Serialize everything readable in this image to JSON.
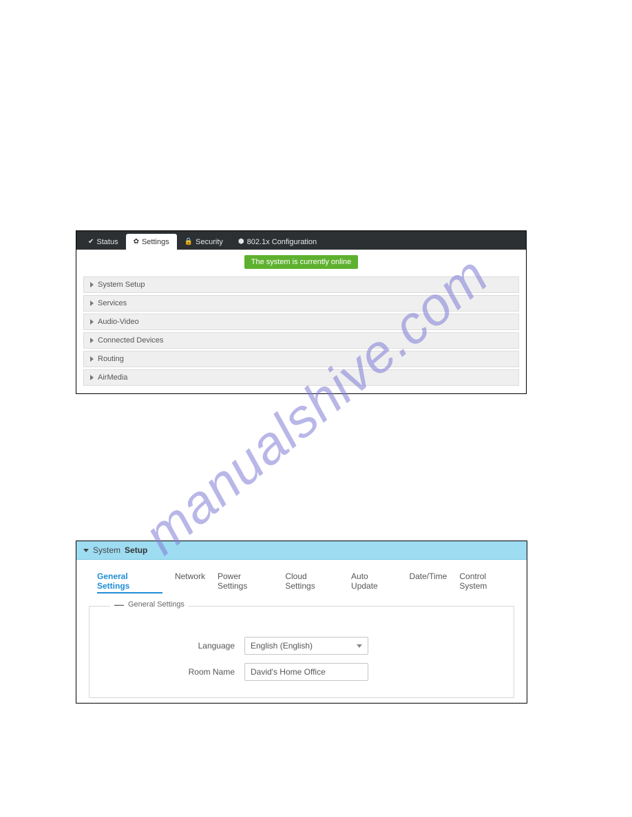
{
  "watermark": "manualshive.com",
  "tabs": [
    {
      "label": "Status"
    },
    {
      "label": "Settings"
    },
    {
      "label": "Security"
    },
    {
      "label": "802.1x Configuration"
    }
  ],
  "status_banner": "The system is currently online",
  "accordion": [
    "System Setup",
    "Services",
    "Audio-Video",
    "Connected Devices",
    "Routing",
    "AirMedia"
  ],
  "system_setup": {
    "header_prefix": "System",
    "header_bold": "Setup",
    "subtabs": [
      "General Settings",
      "Network",
      "Power Settings",
      "Cloud Settings",
      "Auto Update",
      "Date/Time",
      "Control System"
    ],
    "group_title": "General Settings",
    "fields": {
      "language_label": "Language",
      "language_value": "English (English)",
      "room_name_label": "Room Name",
      "room_name_value": "David's Home Office"
    }
  }
}
